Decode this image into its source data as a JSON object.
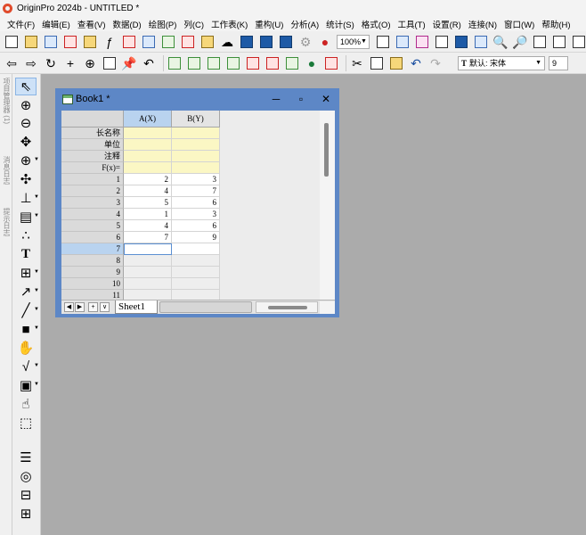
{
  "app": {
    "title": "OriginPro 2024b - UNTITLED *"
  },
  "menu": [
    "文件(F)",
    "编辑(E)",
    "查看(V)",
    "数据(D)",
    "绘图(P)",
    "列(C)",
    "工作表(K)",
    "重构(U)",
    "分析(A)",
    "统计(S)",
    "格式(O)",
    "工具(T)",
    "设置(R)",
    "连接(N)",
    "窗口(W)",
    "帮助(H)"
  ],
  "toolbar": {
    "zoom": "100%",
    "font_name": "默认: 宋体",
    "font_size": "9"
  },
  "side_panels": [
    "项目管理器 (1)",
    "消息日志",
    "提示日志"
  ],
  "book": {
    "title": "Book1 *",
    "columns": [
      "A(X)",
      "B(Y)"
    ],
    "meta_rows": [
      "长名称",
      "单位",
      "注释",
      "F(x)="
    ],
    "rows": [
      {
        "n": "1",
        "a": "2",
        "b": "3"
      },
      {
        "n": "2",
        "a": "4",
        "b": "7"
      },
      {
        "n": "3",
        "a": "5",
        "b": "6"
      },
      {
        "n": "4",
        "a": "1",
        "b": "3"
      },
      {
        "n": "5",
        "a": "4",
        "b": "6"
      },
      {
        "n": "6",
        "a": "7",
        "b": "9"
      },
      {
        "n": "7",
        "a": "",
        "b": ""
      },
      {
        "n": "8",
        "a": "",
        "b": ""
      },
      {
        "n": "9",
        "a": "",
        "b": ""
      },
      {
        "n": "10",
        "a": "",
        "b": ""
      },
      {
        "n": "11",
        "a": "",
        "b": ""
      }
    ],
    "selected_row": "7",
    "sheet": "Sheet1"
  }
}
